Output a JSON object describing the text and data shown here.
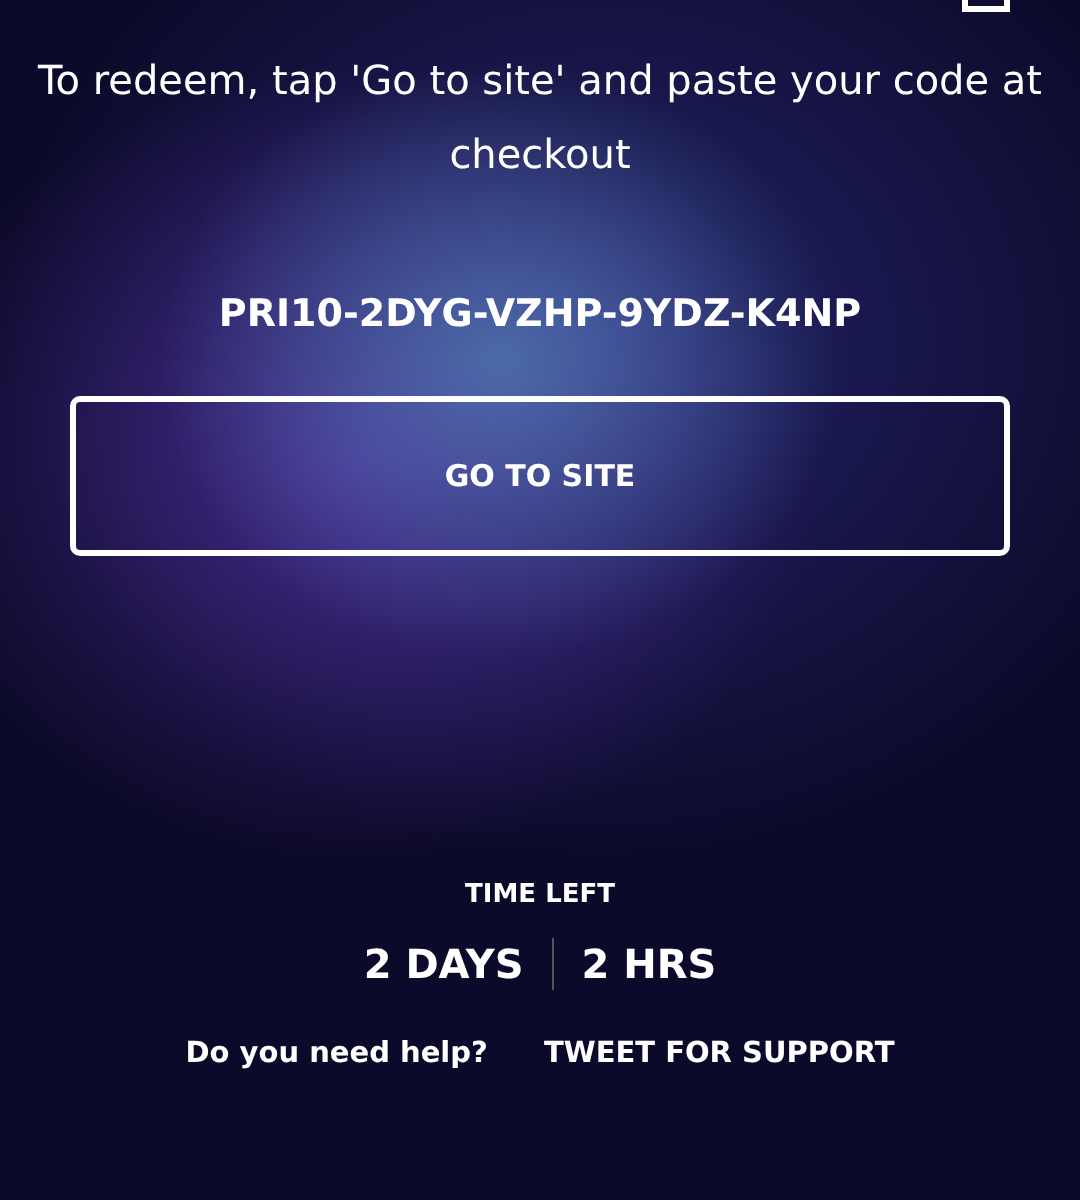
{
  "instructions": "To redeem, tap 'Go to site' and paste your code at checkout",
  "code": "PRI10-2DYG-VZHP-9YDZ-K4NP",
  "button": "GO TO SITE",
  "time_left": {
    "label": "TIME LEFT",
    "values": [
      "2 DAYS",
      "2 HRS"
    ]
  },
  "help": {
    "question": "Do you need help?",
    "link": "TWEET FOR SUPPORT"
  }
}
